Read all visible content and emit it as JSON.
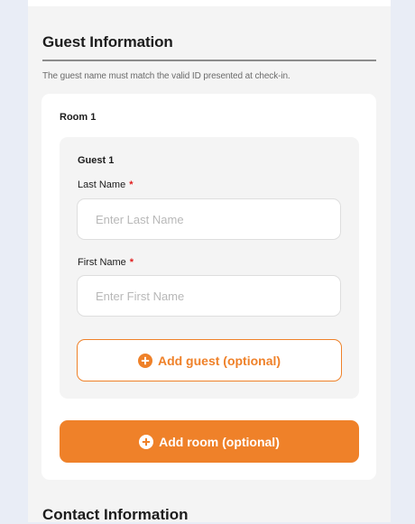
{
  "guest_section": {
    "title": "Guest Information",
    "note": "The guest name must match the valid ID presented at check-in."
  },
  "room": {
    "label": "Room 1",
    "guest": {
      "label": "Guest 1",
      "last_name": {
        "label": "Last Name",
        "required_mark": "*",
        "placeholder": "Enter Last Name",
        "value": ""
      },
      "first_name": {
        "label": "First Name",
        "required_mark": "*",
        "placeholder": "Enter First Name",
        "value": ""
      },
      "add_guest_label": "Add guest (optional)"
    },
    "add_room_label": "Add room (optional)"
  },
  "contact_section": {
    "title": "Contact Information"
  },
  "colors": {
    "accent": "#ef8129",
    "required": "#e11d1d",
    "page_bg": "#e9edf6",
    "panel_bg": "#f4f4f4"
  },
  "icons": {
    "add_guest": "plus-circle-icon",
    "add_room": "plus-circle-icon"
  }
}
